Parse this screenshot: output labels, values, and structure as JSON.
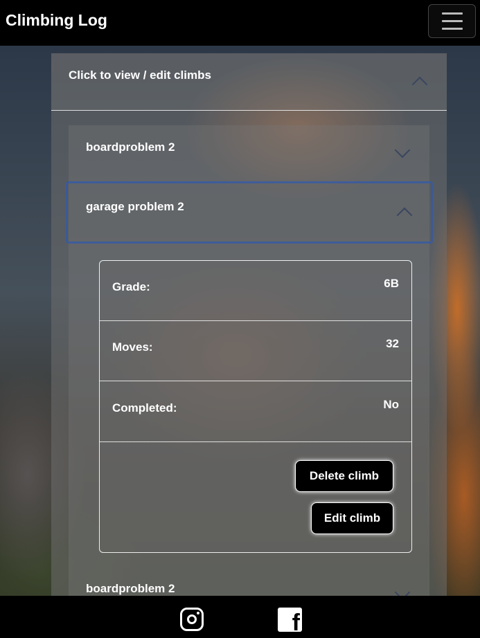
{
  "navbar": {
    "brand": "Climbing Log",
    "menu_icon": "hamburger-menu-icon"
  },
  "accordion": {
    "header_label": "Click to view / edit climbs",
    "items": [
      {
        "label": "boardproblem 2",
        "expanded": false
      },
      {
        "label": "garage problem 2",
        "expanded": true
      },
      {
        "label": "boardproblem 2",
        "expanded": false
      }
    ]
  },
  "climb_details": {
    "grade_label": "Grade:",
    "grade_value": "6B",
    "moves_label": "Moves:",
    "moves_value": "32",
    "completed_label": "Completed:",
    "completed_value": "No",
    "delete_button": "Delete climb",
    "edit_button": "Edit climb"
  },
  "footer": {
    "icons": [
      "instagram-icon",
      "facebook-icon"
    ],
    "facebook_glyph": "f"
  },
  "colors": {
    "navbar_bg": "#000000",
    "active_border": "#325aaa",
    "button_bg": "#000000"
  }
}
